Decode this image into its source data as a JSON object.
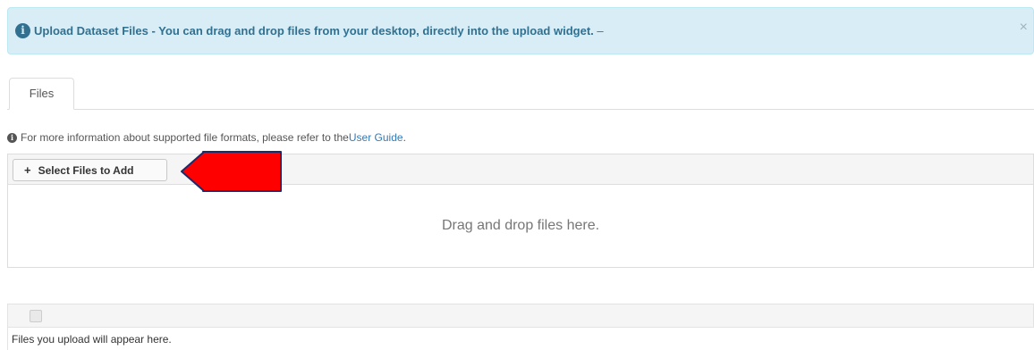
{
  "alert": {
    "icon": "info-circle-icon",
    "message": "Upload Dataset Files - You can drag and drop files from your desktop, directly into the upload widget.",
    "dash": " –",
    "close": "×"
  },
  "tabs": [
    {
      "label": "Files"
    }
  ],
  "help": {
    "icon": "info-circle-icon",
    "text": "For more information about supported file formats, please refer to the ",
    "link": "User Guide",
    "suffix": "."
  },
  "upload": {
    "plus": "+",
    "select_label": "Select Files to Add",
    "drop_text": "Drag and drop files here."
  },
  "annotation": {
    "icon": "red-arrow-pointer",
    "color": "#ff0000",
    "outline": "#1c2a6b"
  },
  "files": {
    "empty_text": "Files you upload will appear here."
  }
}
